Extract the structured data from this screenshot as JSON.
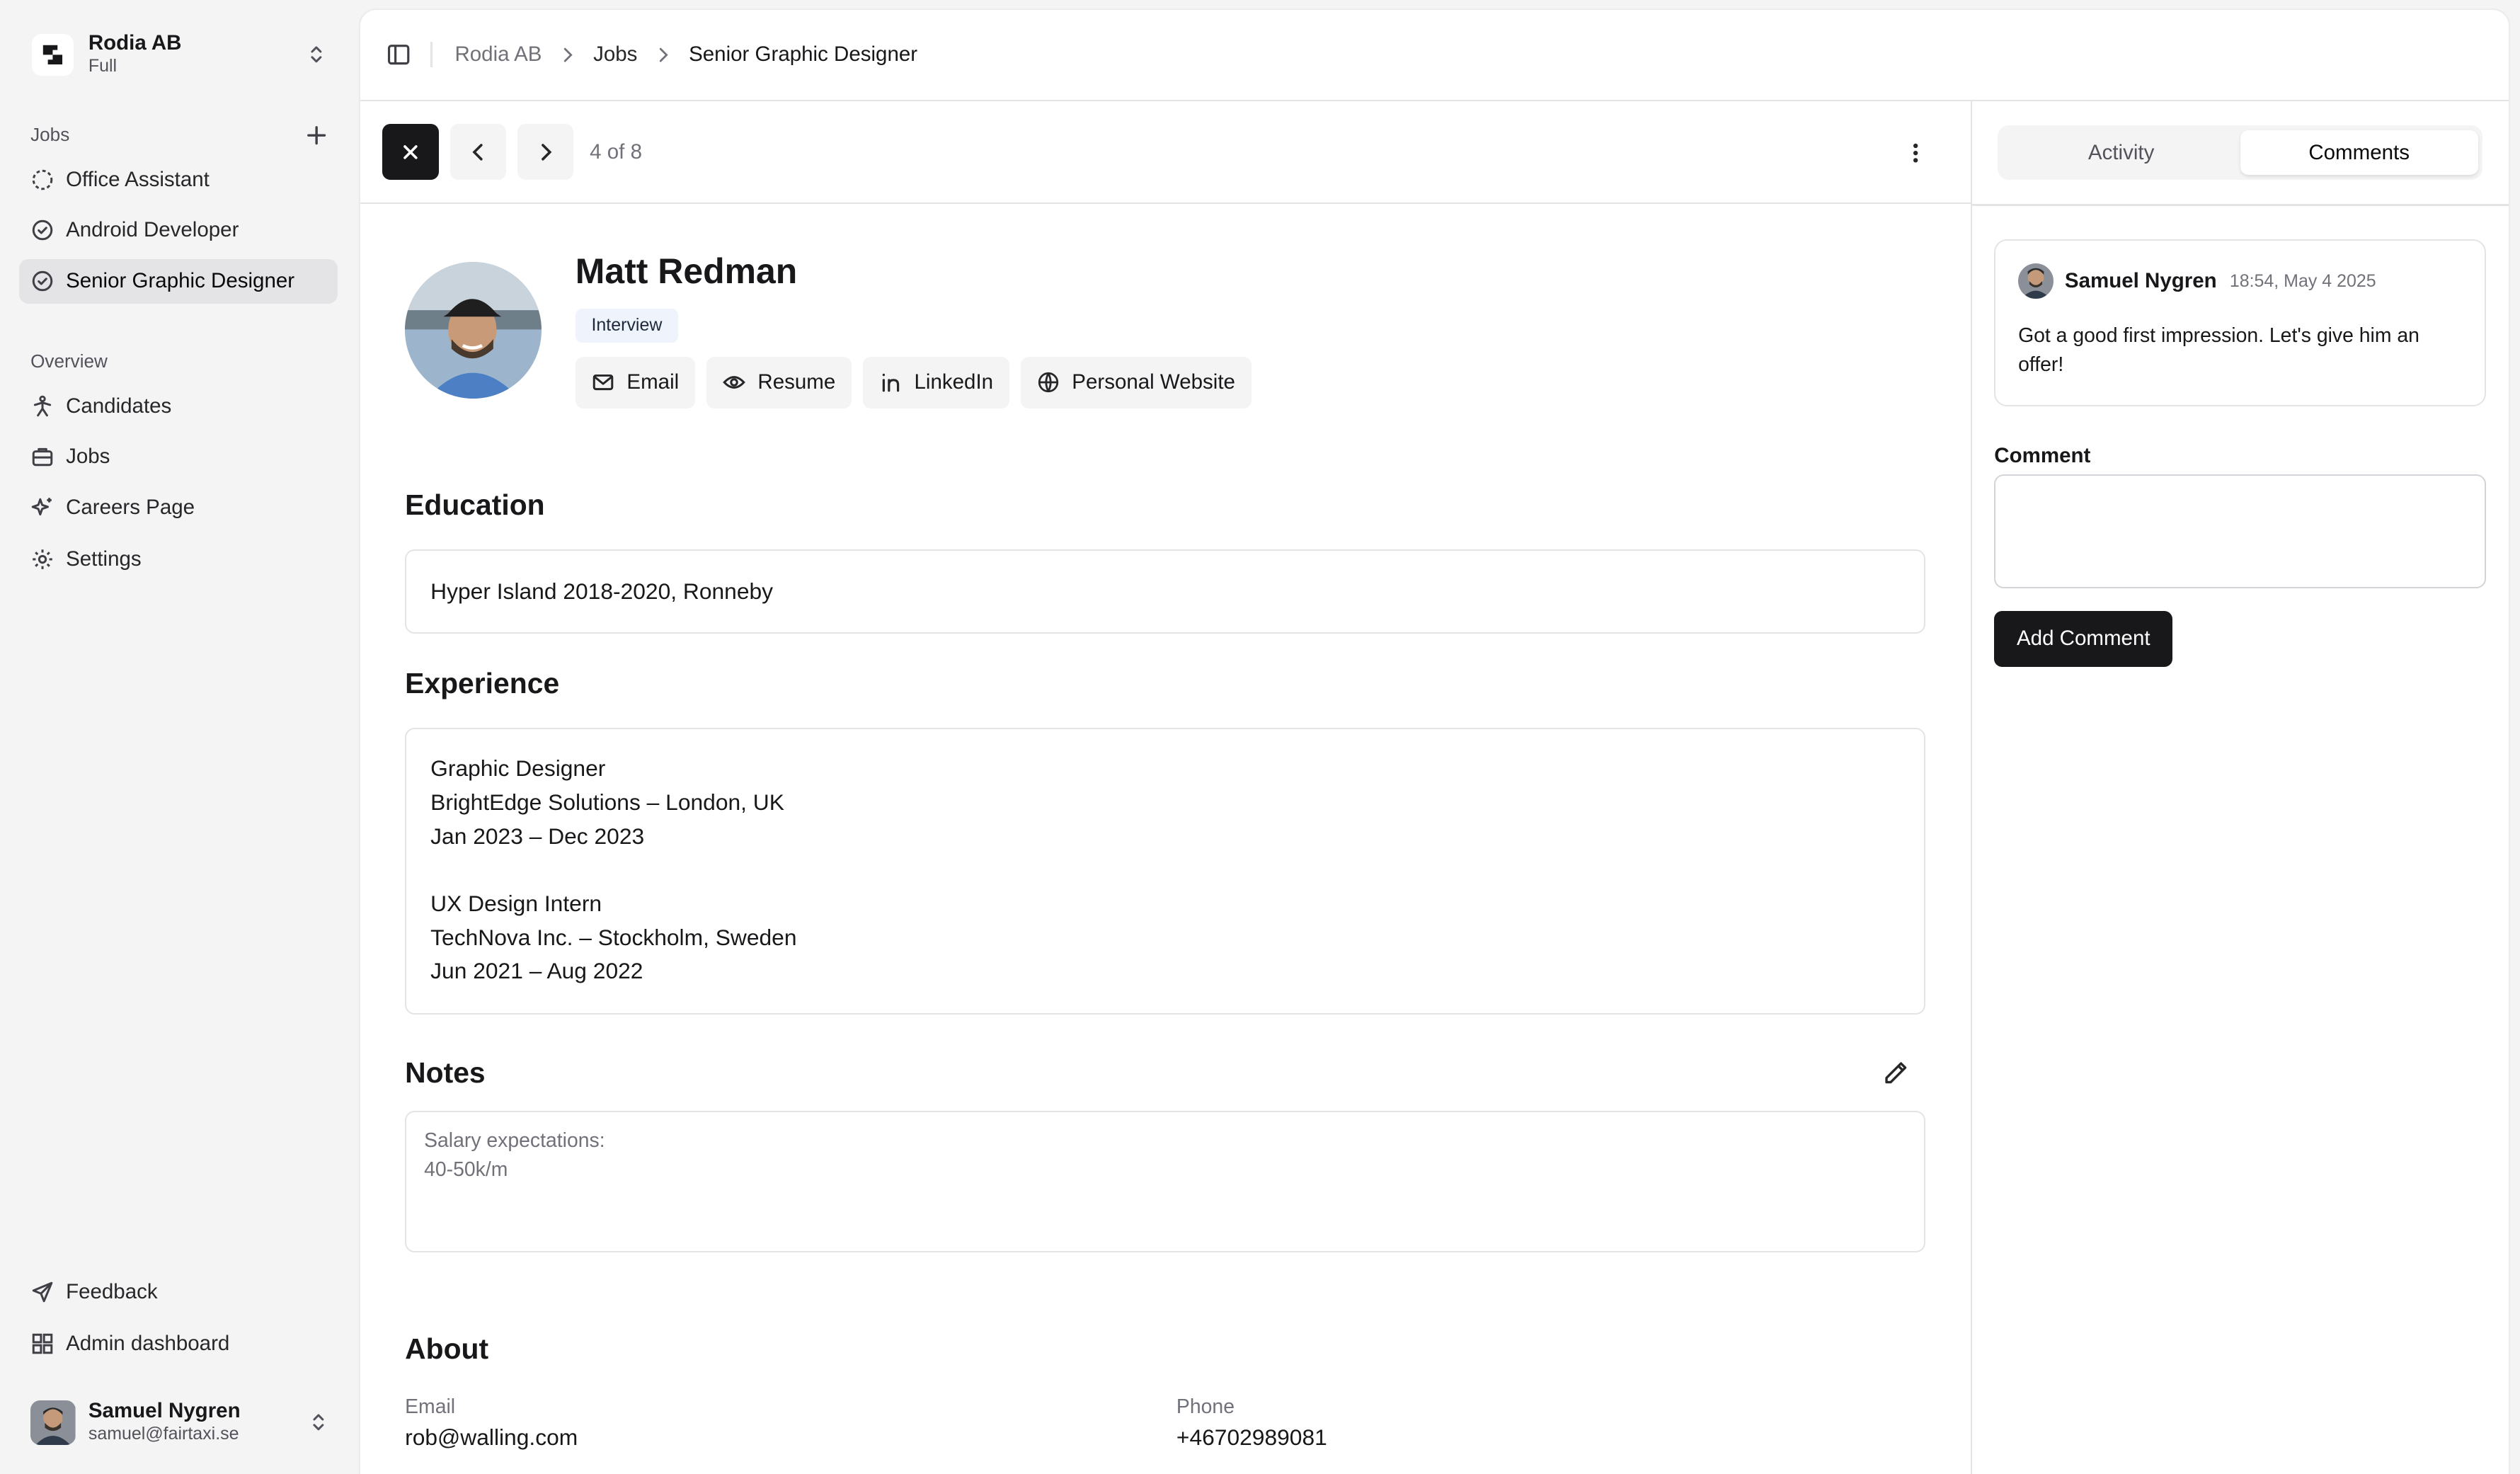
{
  "org": {
    "name": "Rodia AB",
    "plan": "Full"
  },
  "sidebar": {
    "jobs_label": "Jobs",
    "jobs": [
      {
        "label": "Office Assistant",
        "icon": "circle-dashed-icon"
      },
      {
        "label": "Android Developer",
        "icon": "circle-check-icon"
      },
      {
        "label": "Senior Graphic Designer",
        "icon": "circle-check-icon",
        "active": true
      }
    ],
    "overview_label": "Overview",
    "overview": [
      {
        "label": "Candidates",
        "icon": "person-icon"
      },
      {
        "label": "Jobs",
        "icon": "briefcase-icon"
      },
      {
        "label": "Careers Page",
        "icon": "sparkle-icon"
      },
      {
        "label": "Settings",
        "icon": "gear-icon"
      }
    ],
    "bottom": [
      {
        "label": "Feedback",
        "icon": "send-icon"
      },
      {
        "label": "Admin dashboard",
        "icon": "dashboard-icon"
      }
    ],
    "user": {
      "name": "Samuel Nygren",
      "email": "samuel@fairtaxi.se"
    }
  },
  "breadcrumb": [
    "Rodia AB",
    "Jobs",
    "Senior Graphic Designer"
  ],
  "toolbar": {
    "counter": "4 of 8"
  },
  "candidate": {
    "name": "Matt Redman",
    "stage": "Interview",
    "actions": [
      "Email",
      "Resume",
      "LinkedIn",
      "Personal Website"
    ]
  },
  "education": {
    "title": "Education",
    "text": "Hyper Island 2018-2020, Ronneby"
  },
  "experience": {
    "title": "Experience",
    "lines": [
      "Graphic Designer",
      "BrightEdge Solutions – London, UK",
      "Jan 2023 – Dec 2023",
      "",
      "UX Design Intern",
      "TechNova Inc. – Stockholm, Sweden",
      "Jun 2021 – Aug 2022"
    ]
  },
  "notes": {
    "title": "Notes",
    "lines": [
      "Salary expectations:",
      "40-50k/m"
    ]
  },
  "about": {
    "title": "About",
    "email_label": "Email",
    "email": "rob@walling.com",
    "phone_label": "Phone",
    "phone": "+46702989081"
  },
  "right_panel": {
    "tabs": [
      "Activity",
      "Comments"
    ],
    "selected_tab": "Comments",
    "comments": [
      {
        "author": "Samuel Nygren",
        "time": "18:54, May 4 2025",
        "text": "Got a good first impression. Let's give him an offer!"
      }
    ],
    "comment_label": "Comment",
    "add_button": "Add Comment"
  },
  "colors": {
    "primary": "#18181b",
    "badge_bg": "#eef3fc",
    "sidebar_bg": "#f4f4f5"
  }
}
